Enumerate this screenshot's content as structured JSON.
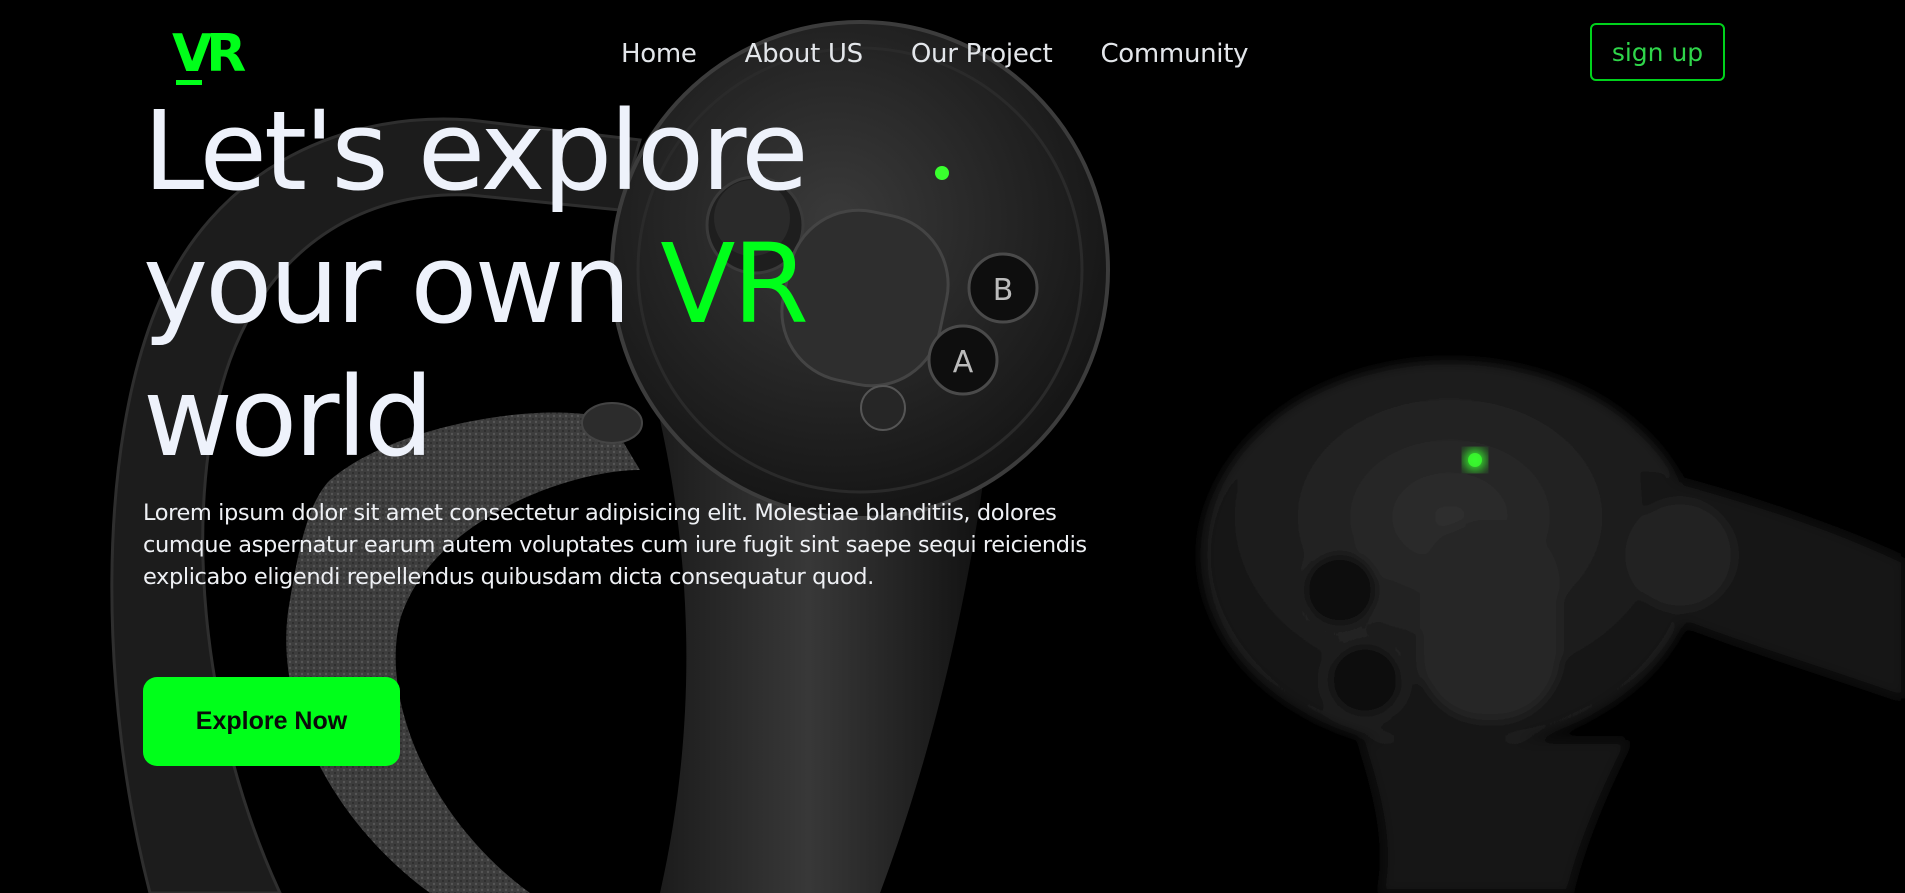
{
  "brand": {
    "logo_text": "VR"
  },
  "nav": {
    "items": [
      {
        "label": "Home"
      },
      {
        "label": "About US"
      },
      {
        "label": "Our Project"
      },
      {
        "label": "Community"
      }
    ],
    "signup_label": "sign up"
  },
  "hero": {
    "headline_line1": "Let's explore",
    "headline_line2": "your own",
    "headline_accent": "VR",
    "headline_line3": "world",
    "description": "Lorem ipsum dolor sit amet consectetur adipisicing elit. Molestiae blanditiis, dolores cumque aspernatur earum autem voluptates cum iure fugit sint saepe sequi reiciendis explicabo eligendi repellendus quibusdam dicta consequatur quod.",
    "cta_label": "Explore Now"
  },
  "background": {
    "image": "vr-controllers-photo",
    "controller_buttons": [
      "B",
      "A"
    ],
    "led_color": "#39ff2e"
  },
  "colors": {
    "accent": "#00ff1a",
    "background": "#000000",
    "text": "#eef2fb"
  }
}
